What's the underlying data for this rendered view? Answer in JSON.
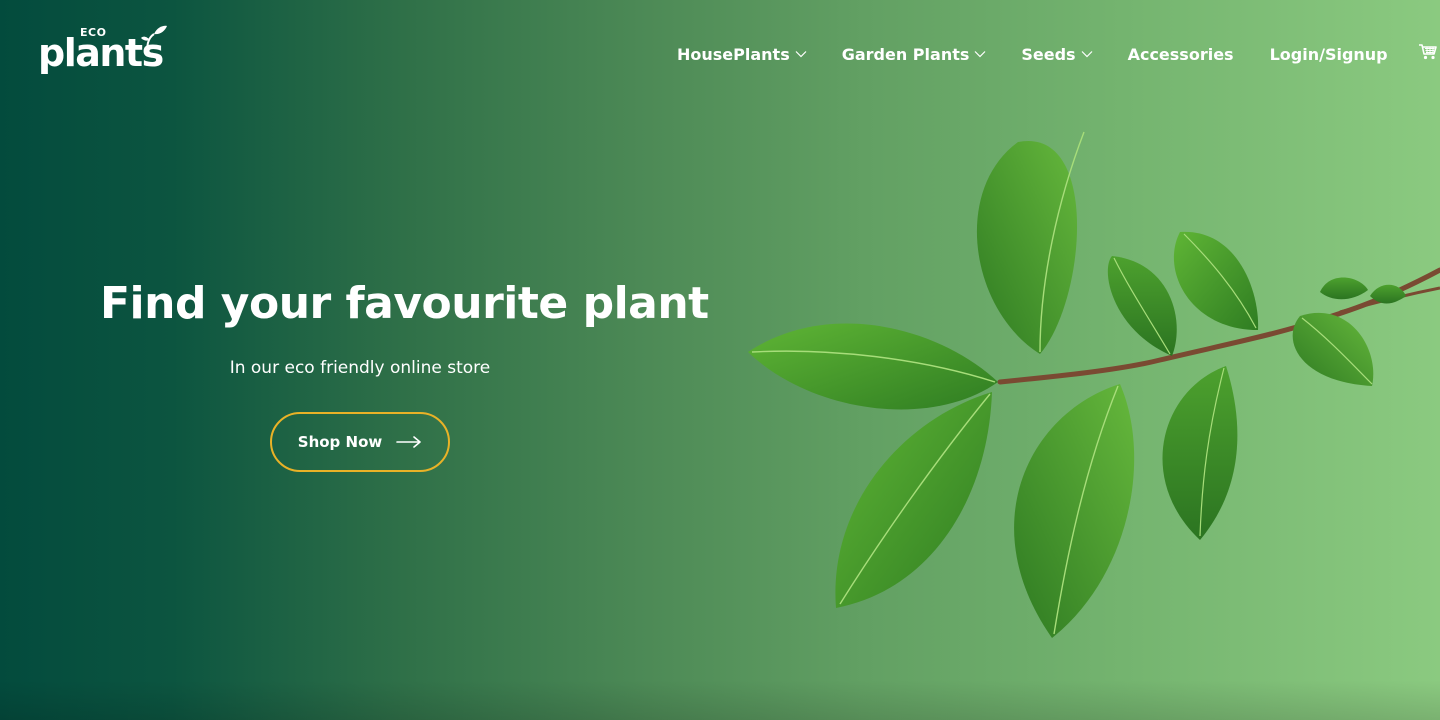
{
  "brand": {
    "prefix": "ECO",
    "name": "plants"
  },
  "nav": {
    "items": [
      {
        "label": "HousePlants",
        "has_dropdown": true
      },
      {
        "label": "Garden Plants",
        "has_dropdown": true
      },
      {
        "label": "Seeds",
        "has_dropdown": true
      },
      {
        "label": "Accessories",
        "has_dropdown": false
      },
      {
        "label": "Login/Signup",
        "has_dropdown": false
      }
    ],
    "cart_icon": "shopping-cart-icon"
  },
  "hero": {
    "title": "Find your favourite plant",
    "subtitle": "In our eco friendly online store",
    "cta_label": "Shop Now",
    "cta_icon": "arrow-right-icon",
    "image": "green-leaf-branch"
  },
  "colors": {
    "gradient_start": "#034b3d",
    "gradient_end": "#8bca80",
    "cta_border": "#e9b227",
    "text": "#ffffff",
    "leaf_dark": "#2f7d22",
    "leaf_light": "#5db233",
    "stem": "#7a4a32"
  }
}
